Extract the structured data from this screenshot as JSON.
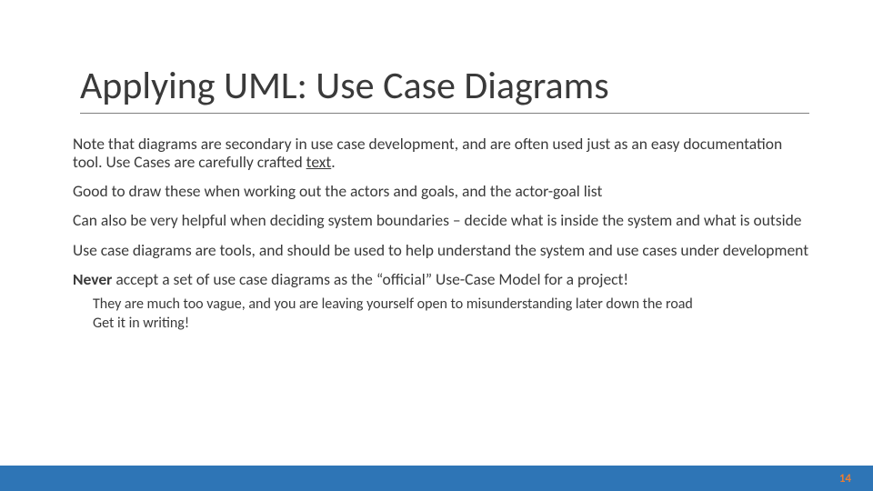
{
  "slide": {
    "title": "Applying UML: Use Case Diagrams",
    "para1_pre": "Note that diagrams are secondary in use case development, and are often used just as an easy documentation tool. Use Cases are carefully crafted ",
    "para1_underlined": "text",
    "para1_post": ".",
    "para2": "Good to draw these when working out the actors and goals, and the actor-goal list",
    "para3": "Can also be very helpful when deciding system boundaries – decide what is inside the system and what is outside",
    "para4": "Use case diagrams are tools, and should be used to help understand the system and use cases under development",
    "para5_bold": "Never",
    "para5_rest": " accept a set of use case diagrams as the “official” Use-Case Model for a project!",
    "sub1": "They are much too vague, and you are leaving yourself open to misunderstanding later down the road",
    "sub2": "Get it in writing!",
    "page_number": "14"
  }
}
